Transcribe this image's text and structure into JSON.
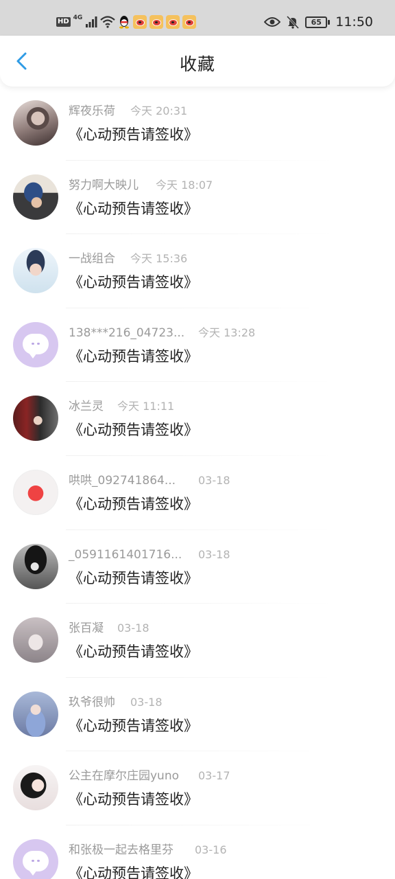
{
  "status_bar": {
    "left_badge": "HD",
    "signal_label": "4G",
    "battery_level": "65",
    "time": "11:50"
  },
  "header": {
    "title": "收藏"
  },
  "items": [
    {
      "name": "辉夜乐荷",
      "time": "今天 20:31",
      "content": "《心动预告请签收》"
    },
    {
      "name": "努力啊大映儿",
      "time": "今天 18:07",
      "content": "《心动预告请签收》"
    },
    {
      "name": "一战组合",
      "time": "今天 15:36",
      "content": "《心动预告请签收》"
    },
    {
      "name": "138***216_04723...",
      "time": "今天 13:28",
      "content": "《心动预告请签收》"
    },
    {
      "name": "冰兰灵",
      "time": "今天 11:11",
      "content": "《心动预告请签收》"
    },
    {
      "name": "哄哄_092741864...",
      "time": "03-18",
      "content": "《心动预告请签收》"
    },
    {
      "name": "_0591161401716...",
      "time": "03-18",
      "content": "《心动预告请签收》"
    },
    {
      "name": "张百凝",
      "time": "03-18",
      "content": "《心动预告请签收》"
    },
    {
      "name": "玖爷很帅",
      "time": "03-18",
      "content": "《心动预告请签收》"
    },
    {
      "name": "公主在摩尔庄园yuno",
      "time": "03-17",
      "content": "《心动预告请签收》"
    },
    {
      "name": "和张极一起去格里芬",
      "time": "03-16",
      "content": "《心动预告请签收》"
    }
  ]
}
